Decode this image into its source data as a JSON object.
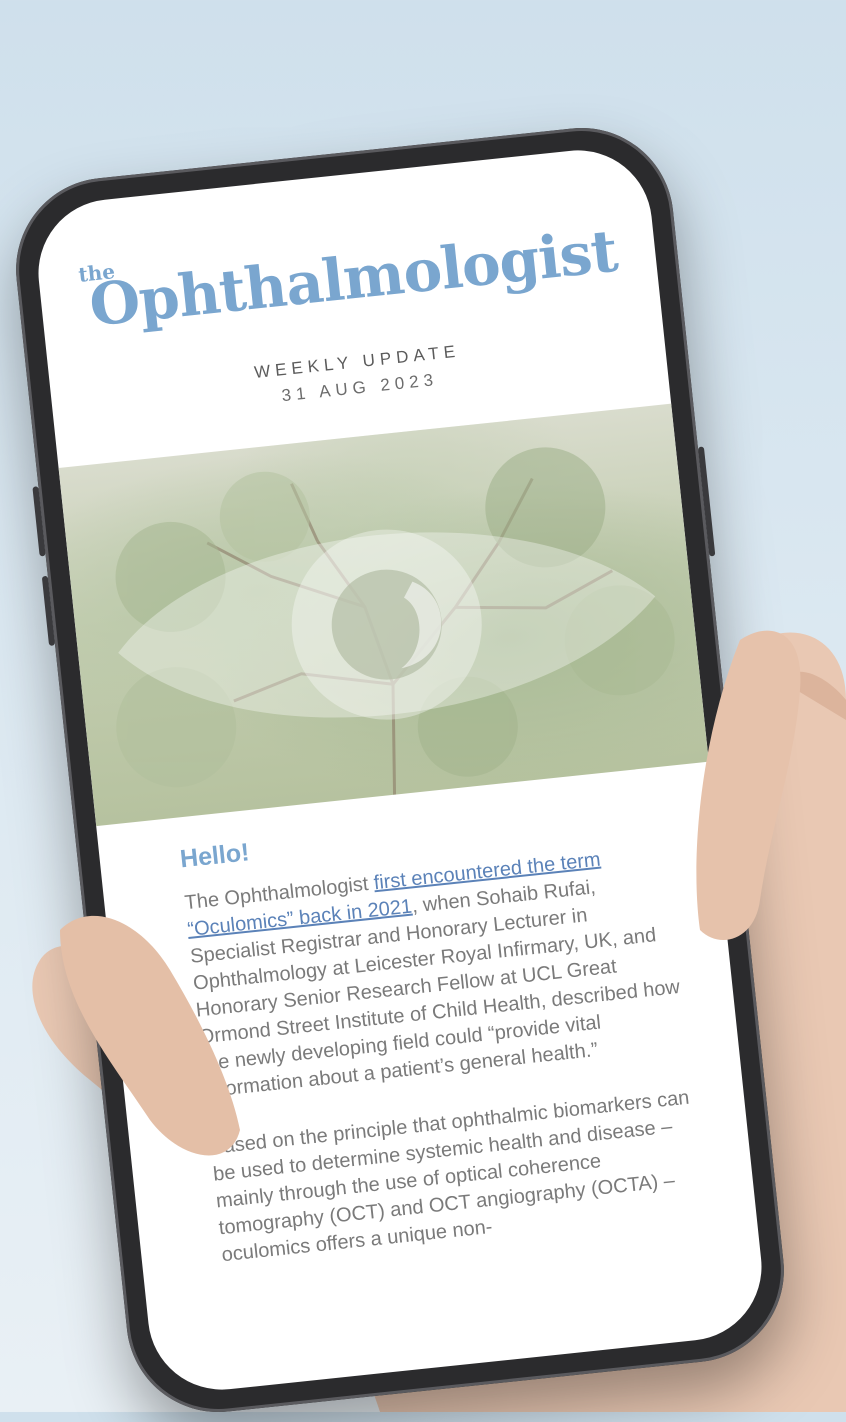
{
  "newsletter": {
    "brand_prefix": "the",
    "brand_name": "Ophthalmologist",
    "subtitle": "WEEKLY UPDATE",
    "date": "31 AUG 2023"
  },
  "article": {
    "greeting": "Hello!",
    "para1_before": "The Ophthalmologist ",
    "para1_link": "first encountered the term “Oculomics” back in 2021",
    "para1_after": ", when Sohaib Rufai, Specialist Registrar and Honorary Lecturer in Ophthalmology at Leicester Royal Infirmary, UK, and Honorary Senior Research Fellow at UCL Great Ormond Street Institute of Child Health, described how the newly developing field could “provide vital information about a patient’s general health.”",
    "para2": "Based on the principle that ophthalmic biomarkers can be used to determine systemic health and disease – mainly through the use of optical coherence tomography (OCT) and OCT angiography (OCTA) – oculomics offers a unique non-"
  },
  "colors": {
    "brand": "#7aa6cf",
    "link": "#5b82b8",
    "body_text": "#7a7a7a"
  },
  "icons": {
    "hero": "eye-icon"
  }
}
